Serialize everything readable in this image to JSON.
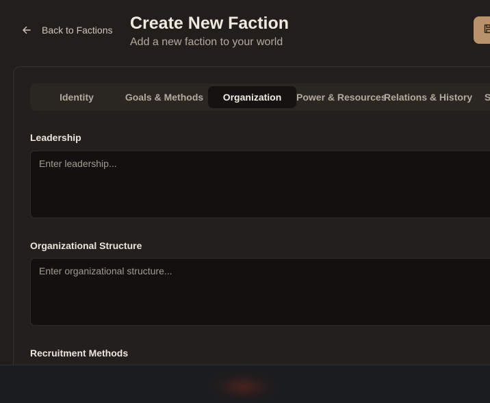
{
  "header": {
    "back_label": "Back to Factions",
    "title": "Create New Faction",
    "subtitle": "Add a new faction to your world"
  },
  "tabs": [
    {
      "label": "Identity",
      "active": false
    },
    {
      "label": "Goals & Methods",
      "active": false
    },
    {
      "label": "Organization",
      "active": true
    },
    {
      "label": "Power & Resources",
      "active": false
    },
    {
      "label": "Relations & History",
      "active": false
    },
    {
      "label": "S",
      "active": false
    }
  ],
  "fields": {
    "leadership": {
      "label": "Leadership",
      "placeholder": "Enter leadership...",
      "value": ""
    },
    "structure": {
      "label": "Organizational Structure",
      "placeholder": "Enter organizational structure...",
      "value": ""
    },
    "recruitment": {
      "label": "Recruitment Methods"
    }
  },
  "colors": {
    "accent": "#b8926a",
    "background": "#211e1b",
    "input_bg": "#121110"
  }
}
